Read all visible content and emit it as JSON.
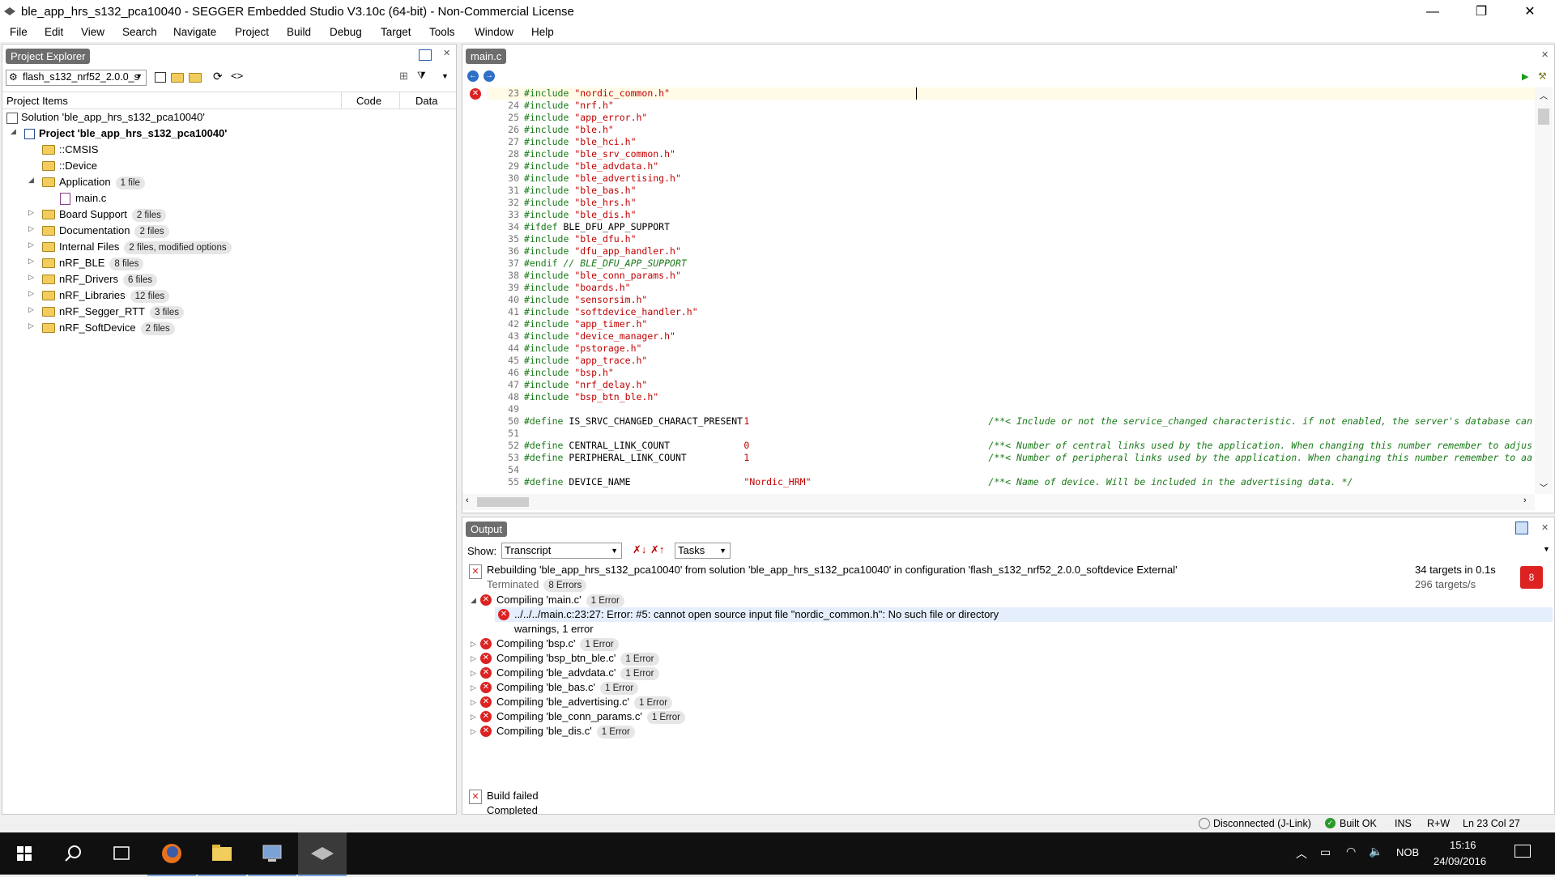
{
  "window": {
    "title": "ble_app_hrs_s132_pca10040 - SEGGER Embedded Studio V3.10c (64-bit) - Non-Commercial License",
    "minimize": "—",
    "restore": "❐",
    "close": "✕"
  },
  "menu": [
    "File",
    "Edit",
    "View",
    "Search",
    "Navigate",
    "Project",
    "Build",
    "Debug",
    "Target",
    "Tools",
    "Window",
    "Help"
  ],
  "project_explorer": {
    "tab_label": "Project Explorer",
    "config_select": "flash_s132_nrf52_2.0.0_s",
    "columns": [
      "Project Items",
      "Code",
      "Data"
    ],
    "solution": "Solution 'ble_app_hrs_s132_pca10040'",
    "project": "Project 'ble_app_hrs_s132_pca10040'",
    "items": [
      {
        "name": "::CMSIS",
        "badge": ""
      },
      {
        "name": "::Device",
        "badge": ""
      },
      {
        "name": "Application",
        "badge": "1 file"
      },
      {
        "name": "main.c",
        "badge": ""
      },
      {
        "name": "Board Support",
        "badge": "2 files"
      },
      {
        "name": "Documentation",
        "badge": "2 files"
      },
      {
        "name": "Internal Files",
        "badge": "2 files, modified options"
      },
      {
        "name": "nRF_BLE",
        "badge": "8 files"
      },
      {
        "name": "nRF_Drivers",
        "badge": "6 files"
      },
      {
        "name": "nRF_Libraries",
        "badge": "12 files"
      },
      {
        "name": "nRF_Segger_RTT",
        "badge": "3 files"
      },
      {
        "name": "nRF_SoftDevice",
        "badge": "2 files"
      }
    ]
  },
  "editor": {
    "tab_label": "main.c",
    "lines": [
      {
        "n": "23",
        "kw": "#include",
        "arg": "\"nordic_common.h\"",
        "type": "inc"
      },
      {
        "n": "24",
        "kw": "#include",
        "arg": "\"nrf.h\"",
        "type": "inc"
      },
      {
        "n": "25",
        "kw": "#include",
        "arg": "\"app_error.h\"",
        "type": "inc"
      },
      {
        "n": "26",
        "kw": "#include",
        "arg": "\"ble.h\"",
        "type": "inc"
      },
      {
        "n": "27",
        "kw": "#include",
        "arg": "\"ble_hci.h\"",
        "type": "inc"
      },
      {
        "n": "28",
        "kw": "#include",
        "arg": "\"ble_srv_common.h\"",
        "type": "inc"
      },
      {
        "n": "29",
        "kw": "#include",
        "arg": "\"ble_advdata.h\"",
        "type": "inc"
      },
      {
        "n": "30",
        "kw": "#include",
        "arg": "\"ble_advertising.h\"",
        "type": "inc"
      },
      {
        "n": "31",
        "kw": "#include",
        "arg": "\"ble_bas.h\"",
        "type": "inc"
      },
      {
        "n": "32",
        "kw": "#include",
        "arg": "\"ble_hrs.h\"",
        "type": "inc"
      },
      {
        "n": "33",
        "kw": "#include",
        "arg": "\"ble_dis.h\"",
        "type": "inc"
      },
      {
        "n": "34",
        "kw": "#ifdef",
        "arg": "BLE_DFU_APP_SUPPORT",
        "type": "plain"
      },
      {
        "n": "35",
        "kw": "#include",
        "arg": "\"ble_dfu.h\"",
        "type": "inc"
      },
      {
        "n": "36",
        "kw": "#include",
        "arg": "\"dfu_app_handler.h\"",
        "type": "inc"
      },
      {
        "n": "37",
        "kw": "#endif",
        "arg": "// BLE_DFU_APP_SUPPORT",
        "type": "cmt"
      },
      {
        "n": "38",
        "kw": "#include",
        "arg": "\"ble_conn_params.h\"",
        "type": "inc"
      },
      {
        "n": "39",
        "kw": "#include",
        "arg": "\"boards.h\"",
        "type": "inc"
      },
      {
        "n": "40",
        "kw": "#include",
        "arg": "\"sensorsim.h\"",
        "type": "inc"
      },
      {
        "n": "41",
        "kw": "#include",
        "arg": "\"softdevice_handler.h\"",
        "type": "inc"
      },
      {
        "n": "42",
        "kw": "#include",
        "arg": "\"app_timer.h\"",
        "type": "inc"
      },
      {
        "n": "43",
        "kw": "#include",
        "arg": "\"device_manager.h\"",
        "type": "inc"
      },
      {
        "n": "44",
        "kw": "#include",
        "arg": "\"pstorage.h\"",
        "type": "inc"
      },
      {
        "n": "45",
        "kw": "#include",
        "arg": "\"app_trace.h\"",
        "type": "inc"
      },
      {
        "n": "46",
        "kw": "#include",
        "arg": "\"bsp.h\"",
        "type": "inc"
      },
      {
        "n": "47",
        "kw": "#include",
        "arg": "\"nrf_delay.h\"",
        "type": "inc"
      },
      {
        "n": "48",
        "kw": "#include",
        "arg": "\"bsp_btn_ble.h\"",
        "type": "inc"
      },
      {
        "n": "49",
        "kw": "",
        "arg": "",
        "type": "blank"
      },
      {
        "n": "50",
        "kw": "#define",
        "arg": "IS_SRVC_CHANGED_CHARACT_PRESENT",
        "val": "1",
        "cmt": "/**< Include or not the service_changed characteristic. if not enabled, the server's database can",
        "type": "def"
      },
      {
        "n": "51",
        "kw": "",
        "arg": "",
        "type": "blank"
      },
      {
        "n": "52",
        "kw": "#define",
        "arg": "CENTRAL_LINK_COUNT",
        "val": "0",
        "cmt": "/**< Number of central links used by the application. When changing this number remember to adjus",
        "type": "def"
      },
      {
        "n": "53",
        "kw": "#define",
        "arg": "PERIPHERAL_LINK_COUNT",
        "val": "1",
        "cmt": "/**< Number of peripheral links used by the application. When changing this number remember to aa",
        "type": "def"
      },
      {
        "n": "54",
        "kw": "",
        "arg": "",
        "type": "blank"
      },
      {
        "n": "55",
        "kw": "#define",
        "arg": "DEVICE_NAME",
        "val": "\"Nordic_HRM\"",
        "cmt": "/**< Name of device. Will be included in the advertising data. */",
        "type": "def"
      }
    ]
  },
  "output": {
    "tab_label": "Output",
    "show_label": "Show:",
    "show_select": "Transcript",
    "tasks_select": "Tasks",
    "rebuild_msg": "Rebuilding 'ble_app_hrs_s132_pca10040' from solution 'ble_app_hrs_s132_pca10040' in configuration 'flash_s132_nrf52_2.0.0_softdevice External'",
    "terminated": "Terminated",
    "terminated_badge": "8 Errors",
    "targets": "34 targets in 0.1s",
    "rate": "296 targets/s",
    "error_count": "8",
    "compile_main": "Compiling 'main.c'",
    "compile_main_badge": "1 Error",
    "error_detail": "../../../main.c:23:27: Error: #5: cannot open source input file \"nordic_common.h\": No such file or directory",
    "warnings": "warnings, 1 error",
    "compiles": [
      {
        "label": "Compiling 'bsp.c'",
        "badge": "1 Error"
      },
      {
        "label": "Compiling 'bsp_btn_ble.c'",
        "badge": "1 Error"
      },
      {
        "label": "Compiling 'ble_advdata.c'",
        "badge": "1 Error"
      },
      {
        "label": "Compiling 'ble_bas.c'",
        "badge": "1 Error"
      },
      {
        "label": "Compiling 'ble_advertising.c'",
        "badge": "1 Error"
      },
      {
        "label": "Compiling 'ble_conn_params.c'",
        "badge": "1 Error"
      },
      {
        "label": "Compiling 'ble_dis.c'",
        "badge": "1 Error"
      }
    ],
    "build_failed": "Build failed",
    "completed": "Completed"
  },
  "status": {
    "connection": "Disconnected (J-Link)",
    "build": "Built OK",
    "mode": "INS",
    "rw": "R+W",
    "position": "Ln 23 Col 27"
  },
  "taskbar": {
    "lang": "NOB",
    "time": "15:16",
    "date": "24/09/2016"
  },
  "colors": {
    "error_red": "#d22222",
    "keyword_green": "#1a7a1a",
    "string_red": "#c00000",
    "pill_gray": "#6d6d6d"
  }
}
